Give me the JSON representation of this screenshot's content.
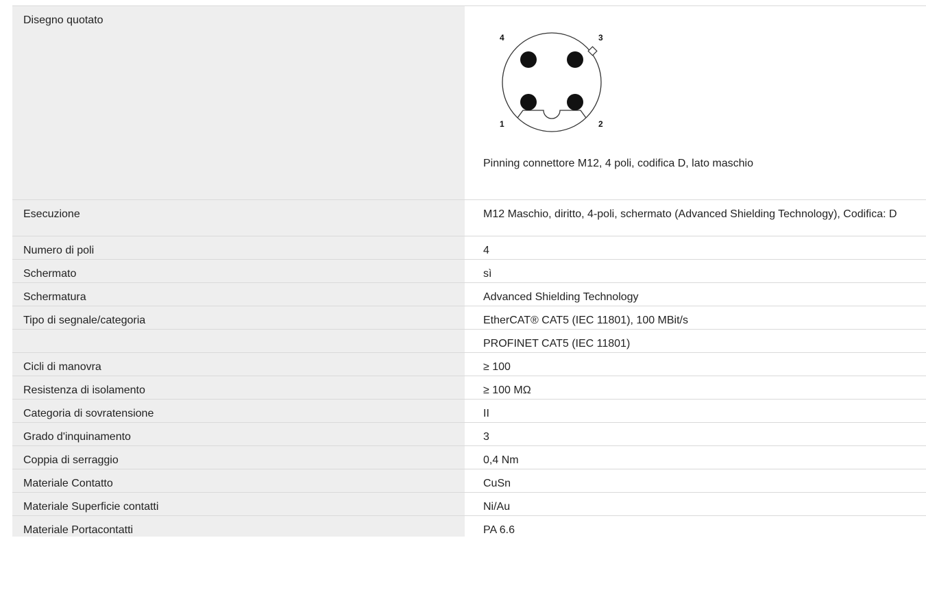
{
  "drawing": {
    "label": "Disegno quotato",
    "caption": "Pinning connettore M12, 4 poli, codifica D, lato maschio",
    "pin_numbers": [
      "4",
      "3",
      "1",
      "2"
    ]
  },
  "rows": [
    {
      "label": "Esecuzione",
      "value": "M12 Maschio, diritto, 4-poli, schermato (Advanced Shielding Technology), Codifica: D"
    },
    {
      "label": "Numero di poli",
      "value": "4"
    },
    {
      "label": "Schermato",
      "value": "sì"
    },
    {
      "label": "Schermatura",
      "value": "Advanced Shielding Technology"
    },
    {
      "label": "Tipo di segnale/categoria",
      "value": "EtherCAT® CAT5 (IEC 11801), 100 MBit/s"
    },
    {
      "label": "",
      "value": "PROFINET CAT5 (IEC 11801)"
    },
    {
      "label": "Cicli di manovra",
      "value": "≥ 100"
    },
    {
      "label": "Resistenza di isolamento",
      "value": "≥ 100 MΩ"
    },
    {
      "label": "Categoria di sovratensione",
      "value": "II"
    },
    {
      "label": "Grado d'inquinamento",
      "value": "3"
    },
    {
      "label": "Coppia di serraggio",
      "value": "0,4 Nm"
    },
    {
      "label": "Materiale Contatto",
      "value": "CuSn"
    },
    {
      "label": "Materiale Superficie contatti",
      "value": "Ni/Au"
    },
    {
      "label": "Materiale Portacontatti",
      "value": "PA 6.6"
    }
  ]
}
